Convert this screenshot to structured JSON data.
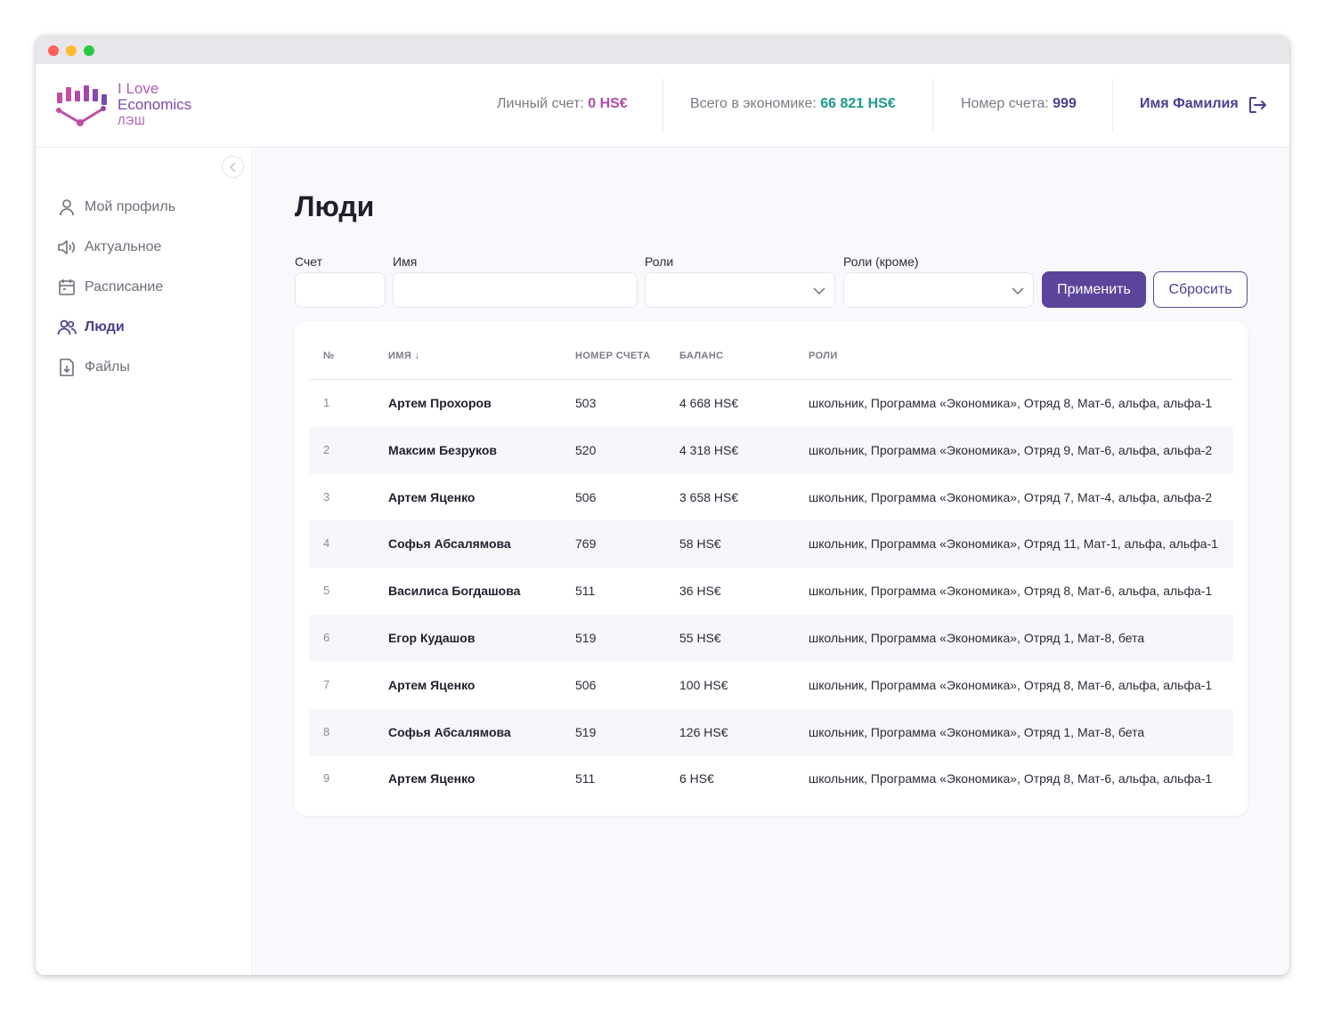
{
  "app": {
    "logo": {
      "line1": "I Love",
      "line2": "Economics",
      "line3": "ЛЭШ"
    }
  },
  "header": {
    "personal_label": "Личный счет: ",
    "personal_value": "0 HS€",
    "economy_label": "Всего в экономике: ",
    "economy_value": "66 821 HS€",
    "account_label": "Номер счета: ",
    "account_value": "999",
    "user_name": "Имя Фамилия"
  },
  "colors": {
    "brand": "#5c449b",
    "personal": "#b04aa8",
    "economy": "#1a9a8c"
  },
  "sidebar": {
    "items": [
      {
        "label": "Мой профиль",
        "icon": "user-icon",
        "active": false
      },
      {
        "label": "Актуальное",
        "icon": "megaphone-icon",
        "active": false
      },
      {
        "label": "Расписание",
        "icon": "calendar-icon",
        "active": false
      },
      {
        "label": "Люди",
        "icon": "people-icon",
        "active": true
      },
      {
        "label": "Файлы",
        "icon": "file-download-icon",
        "active": false
      }
    ]
  },
  "page": {
    "title": "Люди"
  },
  "filters": {
    "account_label": "Счет",
    "name_label": "Имя",
    "roles_label": "Роли",
    "roles_except_label": "Роли (кроме)",
    "apply_label": "Применить",
    "reset_label": "Сбросить"
  },
  "table": {
    "headers": {
      "num": "№",
      "name": "ИМЯ ↓",
      "account": "НОМЕР СЧЕТА",
      "balance": "БАЛАНС",
      "roles": "РОЛИ"
    },
    "rows": [
      {
        "num": "1",
        "name": "Артем Прохоров",
        "account": "503",
        "balance": "4 668 HS€",
        "roles": "школьник, Программа «Экономика», Отряд 8, Мат-6, альфа, альфа-1"
      },
      {
        "num": "2",
        "name": "Максим Безруков",
        "account": "520",
        "balance": "4 318 HS€",
        "roles": "школьник, Программа «Экономика», Отряд 9, Мат-6, альфа, альфа-2"
      },
      {
        "num": "3",
        "name": "Артем Яценко",
        "account": "506",
        "balance": "3 658 HS€",
        "roles": "школьник, Программа «Экономика», Отряд 7, Мат-4, альфа, альфа-2"
      },
      {
        "num": "4",
        "name": "Софья Абсалямова",
        "account": "769",
        "balance": "58 HS€",
        "roles": "школьник, Программа «Экономика», Отряд 11, Мат-1, альфа, альфа-1"
      },
      {
        "num": "5",
        "name": "Василиса Богдашова",
        "account": "511",
        "balance": "36 HS€",
        "roles": "школьник, Программа «Экономика», Отряд 8, Мат-6, альфа, альфа-1"
      },
      {
        "num": "6",
        "name": "Егор Кудашов",
        "account": "519",
        "balance": "55 HS€",
        "roles": "школьник, Программа «Экономика», Отряд 1, Мат-8, бета"
      },
      {
        "num": "7",
        "name": "Артем Яценко",
        "account": "506",
        "balance": "100 HS€",
        "roles": "школьник, Программа «Экономика», Отряд 8, Мат-6, альфа, альфа-1"
      },
      {
        "num": "8",
        "name": "Софья Абсалямова",
        "account": "519",
        "balance": "126 HS€",
        "roles": "школьник, Программа «Экономика», Отряд 1, Мат-8, бета"
      },
      {
        "num": "9",
        "name": "Артем Яценко",
        "account": "511",
        "balance": "6 HS€",
        "roles": "школьник, Программа «Экономика», Отряд 8, Мат-6, альфа, альфа-1"
      }
    ]
  }
}
